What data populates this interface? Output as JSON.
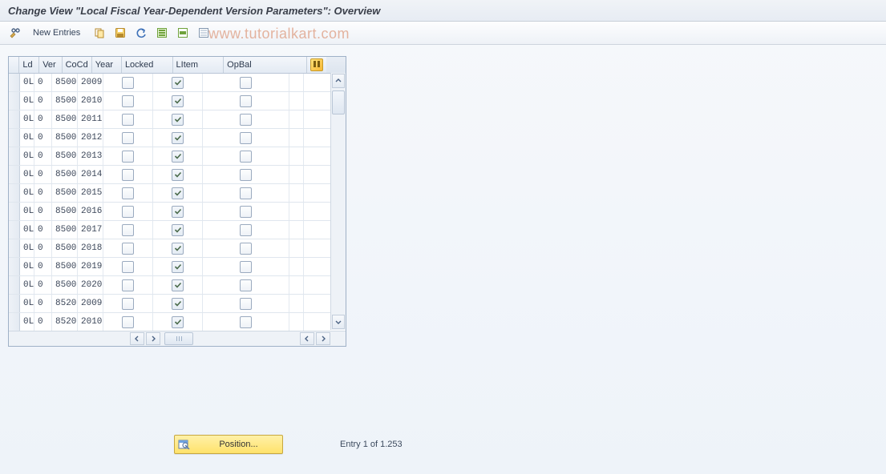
{
  "title": "Change View \"Local Fiscal Year-Dependent Version Parameters\": Overview",
  "watermark": "www.tutorialkart.com",
  "toolbar": {
    "new_entries_label": "New Entries",
    "icons": {
      "toggle": "toggle-edit-icon",
      "copy": "copy-icon",
      "delete": "delete-icon",
      "undo": "undo-icon",
      "select_all": "select-all-icon",
      "deselect_all": "deselect-all-icon",
      "table_settings": "table-settings-icon"
    }
  },
  "table": {
    "headers": {
      "ld": "Ld",
      "ver": "Ver",
      "cocd": "CoCd",
      "year": "Year",
      "locked": "Locked",
      "litem": "LItem",
      "opbal": "OpBal"
    },
    "rows": [
      {
        "ld": "0L",
        "ver": "0",
        "cocd": "8500",
        "year": "2009",
        "locked": false,
        "litem": true,
        "opbal": false
      },
      {
        "ld": "0L",
        "ver": "0",
        "cocd": "8500",
        "year": "2010",
        "locked": false,
        "litem": true,
        "opbal": false
      },
      {
        "ld": "0L",
        "ver": "0",
        "cocd": "8500",
        "year": "2011",
        "locked": false,
        "litem": true,
        "opbal": false
      },
      {
        "ld": "0L",
        "ver": "0",
        "cocd": "8500",
        "year": "2012",
        "locked": false,
        "litem": true,
        "opbal": false
      },
      {
        "ld": "0L",
        "ver": "0",
        "cocd": "8500",
        "year": "2013",
        "locked": false,
        "litem": true,
        "opbal": false
      },
      {
        "ld": "0L",
        "ver": "0",
        "cocd": "8500",
        "year": "2014",
        "locked": false,
        "litem": true,
        "opbal": false
      },
      {
        "ld": "0L",
        "ver": "0",
        "cocd": "8500",
        "year": "2015",
        "locked": false,
        "litem": true,
        "opbal": false
      },
      {
        "ld": "0L",
        "ver": "0",
        "cocd": "8500",
        "year": "2016",
        "locked": false,
        "litem": true,
        "opbal": false
      },
      {
        "ld": "0L",
        "ver": "0",
        "cocd": "8500",
        "year": "2017",
        "locked": false,
        "litem": true,
        "opbal": false
      },
      {
        "ld": "0L",
        "ver": "0",
        "cocd": "8500",
        "year": "2018",
        "locked": false,
        "litem": true,
        "opbal": false
      },
      {
        "ld": "0L",
        "ver": "0",
        "cocd": "8500",
        "year": "2019",
        "locked": false,
        "litem": true,
        "opbal": false
      },
      {
        "ld": "0L",
        "ver": "0",
        "cocd": "8500",
        "year": "2020",
        "locked": false,
        "litem": true,
        "opbal": false
      },
      {
        "ld": "0L",
        "ver": "0",
        "cocd": "8520",
        "year": "2009",
        "locked": false,
        "litem": true,
        "opbal": false
      },
      {
        "ld": "0L",
        "ver": "0",
        "cocd": "8520",
        "year": "2010",
        "locked": false,
        "litem": true,
        "opbal": false
      }
    ]
  },
  "footer": {
    "position_label": "Position...",
    "entry_status": "Entry 1 of 1.253"
  }
}
